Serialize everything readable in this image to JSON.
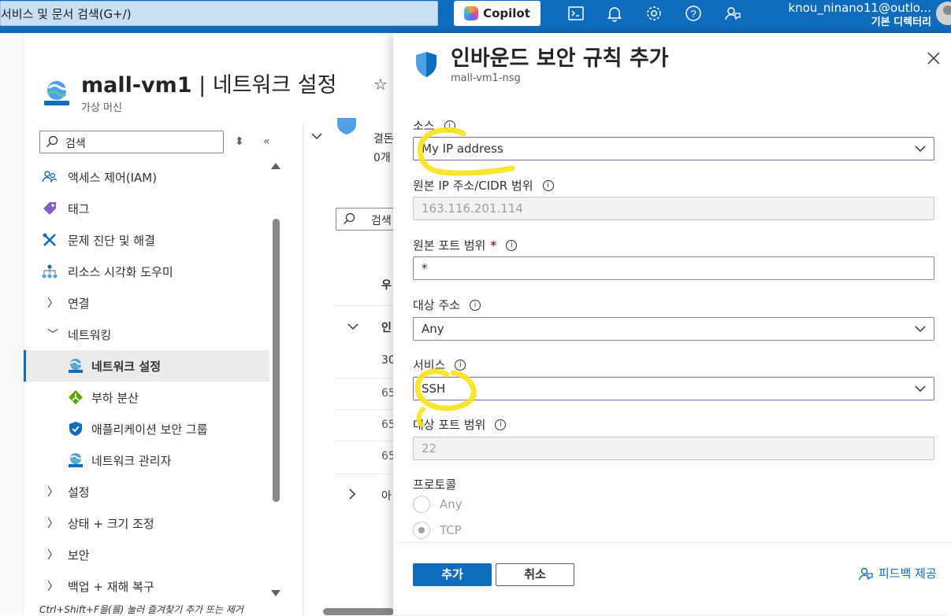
{
  "topbar": {
    "search_text": "서비스 및 문서 검색(G+/)",
    "copilot_label": "Copilot",
    "account_email": "knou_ninano11@outlo...",
    "account_directory": "기본 디렉터리"
  },
  "blade": {
    "title_bold": "mall-vm1",
    "title_rest": " | 네트워크 설정",
    "subtitle": "가상 머신",
    "search_placeholder": "검색",
    "hint": "Ctrl+Shift+F을(를) 눌러 즐겨찾기 추가 또는 제거"
  },
  "nav": {
    "items": [
      {
        "label": "액세스 제어(IAM)"
      },
      {
        "label": "태그"
      },
      {
        "label": "문제 진단 및 해결"
      },
      {
        "label": "리소스 시각화 도우미"
      },
      {
        "label": "연결"
      },
      {
        "label": "네트워킹"
      },
      {
        "label": "네트워크 설정"
      },
      {
        "label": "부하 분산"
      },
      {
        "label": "애플리케이션 보안 그룹"
      },
      {
        "label": "네트워크 관리자"
      },
      {
        "label": "설정"
      },
      {
        "label": "상태 + 크기 조정"
      },
      {
        "label": "보안"
      },
      {
        "label": "백업 + 재해 복구"
      }
    ]
  },
  "middle": {
    "line1": "결돈",
    "line2": "0개",
    "search_placeholder": "검색",
    "col_header": "우",
    "group_label": "인",
    "row1": "30",
    "row2": "65",
    "row3": "65",
    "row4": "65",
    "group2_label": "아"
  },
  "panel": {
    "title": "인바운드 보안 규칙 추가",
    "subtitle": "mall-vm1-nsg",
    "source_label": "소스",
    "source_value": "My IP address",
    "source_ip_label": "원본 IP 주소/CIDR 범위",
    "source_ip_value": "163.116.201.114",
    "source_port_label": "원본 포트 범위",
    "source_port_required": "*",
    "source_port_value": "*",
    "dest_label": "대상 주소",
    "dest_value": "Any",
    "service_label": "서비스",
    "service_value": "SSH",
    "dest_port_label": "대상 포트 범위",
    "dest_port_value": "22",
    "protocol_label": "프로토콜",
    "protocol_options": [
      "Any",
      "TCP"
    ],
    "add_button": "추가",
    "cancel_button": "취소",
    "feedback": "피드백 제공"
  }
}
